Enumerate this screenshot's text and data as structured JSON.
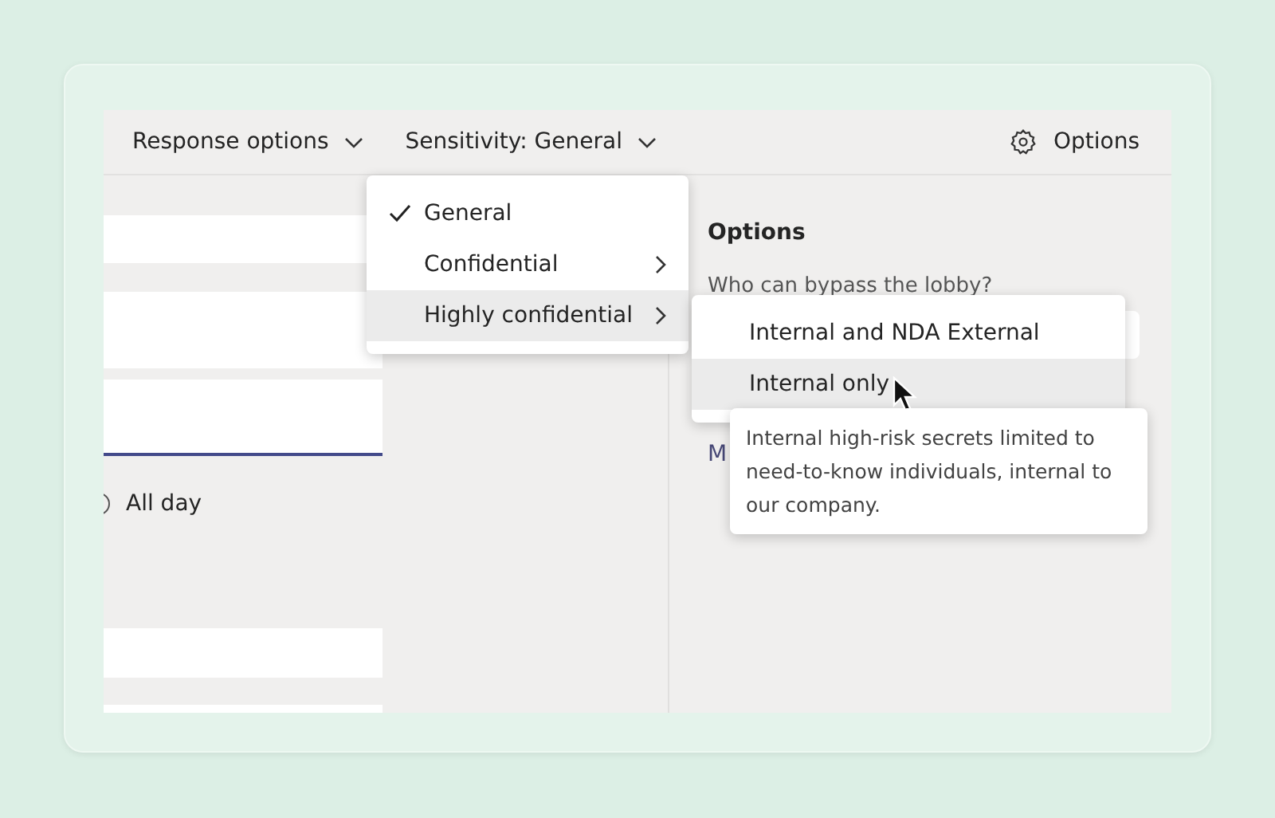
{
  "toolbar": {
    "menus": [
      {
        "label": "Response options"
      },
      {
        "label": "Sensitivity: General"
      }
    ],
    "options_button": {
      "label": "Options"
    }
  },
  "left_pane": {
    "all_day": {
      "label": "All day",
      "checked": false
    }
  },
  "options_panel": {
    "title": "Options",
    "question": "Who can bypass the lobby?",
    "link": "M"
  },
  "sensitivity_menu": {
    "items": [
      {
        "label": "General",
        "checked": true,
        "highlighted": false,
        "has_submenu": false
      },
      {
        "label": "Confidential",
        "checked": false,
        "highlighted": false,
        "has_submenu": true
      },
      {
        "label": "Highly confidential",
        "checked": false,
        "highlighted": true,
        "has_submenu": true
      }
    ]
  },
  "submenu": {
    "items": [
      {
        "label": "Internal and NDA External",
        "highlighted": false
      },
      {
        "label": "Internal only",
        "highlighted": true
      }
    ]
  },
  "tooltip": {
    "text": "Internal high-risk secrets limited to need-to-know individuals, internal to our company."
  }
}
